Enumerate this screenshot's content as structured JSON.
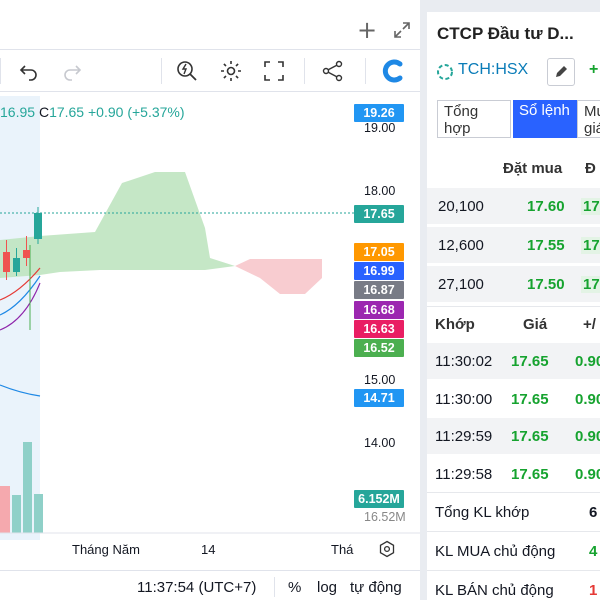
{
  "left_header": {
    "add_icon": "+",
    "expand_icon": "expand"
  },
  "ohlc": {
    "low_fragment": "16.95",
    "close_label": "C",
    "close_value": "17.65",
    "change": "+0.90 (+5.37%)"
  },
  "price_axis": {
    "labels": [
      "19.00",
      "18.00",
      "15.00",
      "14.00"
    ],
    "tags": [
      {
        "text": "19.26",
        "color": "#2196f3"
      },
      {
        "text": "17.65",
        "color": "#26a69a"
      },
      {
        "text": "17.05",
        "color": "#ff9800"
      },
      {
        "text": "16.99",
        "color": "#2962ff"
      },
      {
        "text": "16.87",
        "color": "#787b86"
      },
      {
        "text": "16.68",
        "color": "#9c27b0"
      },
      {
        "text": "16.63",
        "color": "#e91e63"
      },
      {
        "text": "16.52",
        "color": "#4caf50"
      },
      {
        "text": "14.71",
        "color": "#2196f3"
      },
      {
        "text": "6.152M",
        "color": "#26a69a"
      }
    ],
    "partial_label": "16.52M"
  },
  "time_axis": {
    "labels": [
      "Tháng Năm",
      "14",
      "Thá"
    ]
  },
  "bottom_bar": {
    "time": "11:37:54 (UTC+7)",
    "percent": "%",
    "log": "log",
    "auto": "tự động"
  },
  "right_panel": {
    "title": "CTCP Đầu tư D...",
    "symbol": "TCH:HSX",
    "change_partial": "+",
    "tabs": [
      {
        "label": "Tổng hợp",
        "active": false
      },
      {
        "label": "Sổ lệnh",
        "active": true
      },
      {
        "label": "Mu giá",
        "active": false
      }
    ],
    "orderbook": {
      "headers": [
        "Đặt mua",
        "Đ"
      ],
      "rows": [
        {
          "volume": "20,100",
          "price": "17.60",
          "next": "17"
        },
        {
          "volume": "12,600",
          "price": "17.55",
          "next": "17"
        },
        {
          "volume": "27,100",
          "price": "17.50",
          "next": "17"
        }
      ]
    },
    "trades": {
      "headers": [
        "Khớp",
        "Giá",
        "+/"
      ],
      "rows": [
        {
          "time": "11:30:02",
          "price": "17.65",
          "change": "0.90"
        },
        {
          "time": "11:30:00",
          "price": "17.65",
          "change": "0.90"
        },
        {
          "time": "11:29:59",
          "price": "17.65",
          "change": "0.90"
        },
        {
          "time": "11:29:58",
          "price": "17.65",
          "change": "0.90"
        }
      ]
    },
    "stats": [
      {
        "label": "Tổng KL khớp",
        "value": "6"
      },
      {
        "label": "KL MUA chủ động",
        "value": "4"
      },
      {
        "label": "KL BÁN chủ động",
        "value": "1"
      }
    ]
  }
}
